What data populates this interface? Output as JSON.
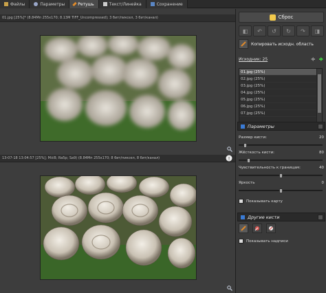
{
  "tabs": [
    {
      "label": "Файлы",
      "icon": "folder-icon"
    },
    {
      "label": "Параметры",
      "icon": "gear-icon"
    },
    {
      "label": "Ретушь",
      "icon": "brush-icon",
      "active": true
    },
    {
      "label": "Текст/Линейка",
      "icon": "text-icon"
    },
    {
      "label": "Сохранение",
      "icon": "save-icon"
    }
  ],
  "top_info": "01.jpg [25%]* (8.84Mп 255x170; 8.13M TIFF_Uncompressed); 3 бит/пиксел, 3 бит/канал)",
  "bottom_info": "13-07-18 13:04:57 [25%]; M±B; Ra5p; Sa9) (8.84Mп 255x170; 8 бит/пиксел, 8 бит/канал)",
  "right_panel": {
    "reset_label": "Сброс",
    "copy_label": "Копировать исходн. область",
    "sources_label": "Исходник: 25",
    "files": [
      "01.jpg (25%)",
      "02.jpg (25%)",
      "03.jpg (25%)",
      "04.jpg (25%)",
      "05.jpg (25%)",
      "06.jpg (25%)",
      "07.jpg (25%)"
    ],
    "params_header": "Параметры",
    "sliders": [
      {
        "label": "Размер кисти:",
        "value": "20",
        "level": 0.06
      },
      {
        "label": "Жёсткость кисти:",
        "value": "80",
        "level": 0.1
      },
      {
        "label": "Чувствительность к границам:",
        "value": "40",
        "level": 0.5
      },
      {
        "label": "Яркость",
        "value": "0",
        "level": 0.5
      }
    ],
    "show_map_label": "Показывать карту",
    "other_brushes_header": "Другие кисти",
    "show_captions_label": "Показывать надписи"
  },
  "colors": {
    "accent_green": "#3ec43e",
    "accent_blue": "#3a7bd5",
    "brush_orange": "#e08a2a"
  }
}
